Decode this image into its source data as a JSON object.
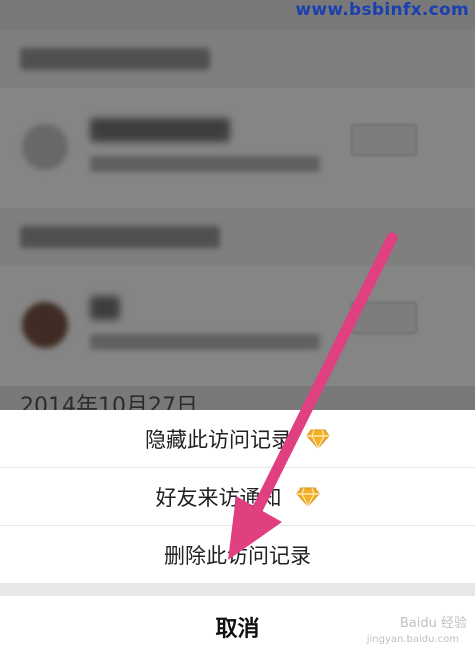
{
  "watermark": "www.bsbinfx.com",
  "background": {
    "date_text": "2014年10月27日"
  },
  "action_sheet": {
    "items": [
      {
        "label": "隐藏此访问记录",
        "icon": "diamond-icon"
      },
      {
        "label": "好友来访通知",
        "icon": "diamond-icon"
      },
      {
        "label": "删除此访问记录"
      }
    ],
    "cancel_label": "取消"
  },
  "colors": {
    "arrow": "#e0407f",
    "diamond": "#f2b02a"
  },
  "bottom_watermark": {
    "brand": "Baidu 经验",
    "site": "jingyan.baidu.com"
  }
}
